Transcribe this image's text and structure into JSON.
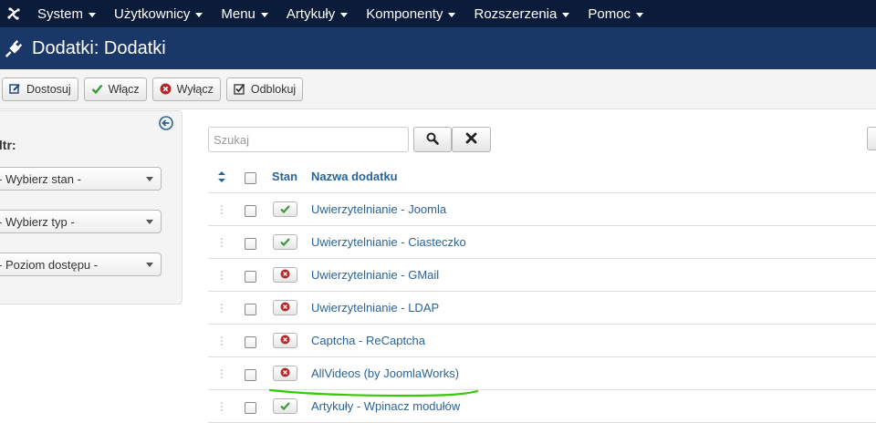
{
  "nav": {
    "items": [
      {
        "label": "System"
      },
      {
        "label": "Użytkownicy"
      },
      {
        "label": "Menu"
      },
      {
        "label": "Artykuły"
      },
      {
        "label": "Komponenty"
      },
      {
        "label": "Rozszerzenia"
      },
      {
        "label": "Pomoc"
      }
    ]
  },
  "header": {
    "title": "Dodatki: Dodatki"
  },
  "toolbar": {
    "customize": "Dostosuj",
    "enable": "Włącz",
    "disable": "Wyłącz",
    "unlock": "Odblokuj"
  },
  "sidebar": {
    "filter_label": "iltr:",
    "state_select": "- Wybierz stan -",
    "type_select": "- Wybierz typ -",
    "access_select": "- Poziom dostępu -"
  },
  "search": {
    "placeholder": "Szukaj"
  },
  "table": {
    "headers": {
      "status": "Stan",
      "name": "Nazwa dodatku"
    },
    "rows": [
      {
        "name": "Uwierzytelnianie - Joomla",
        "enabled": true
      },
      {
        "name": "Uwierzytelnianie - Ciasteczko",
        "enabled": true
      },
      {
        "name": "Uwierzytelnianie - GMail",
        "enabled": false
      },
      {
        "name": "Uwierzytelnianie - LDAP",
        "enabled": false
      },
      {
        "name": "Captcha - ReCaptcha",
        "enabled": false
      },
      {
        "name": "AllVideos (by JoomlaWorks)",
        "enabled": false
      },
      {
        "name": "Artykuły - Wpinacz modułów",
        "enabled": true
      }
    ]
  },
  "colors": {
    "navbar": "#0b1c3b",
    "header": "#1a3867",
    "link": "#2a6496",
    "enabled": "#3c9a3c",
    "disabled": "#b02a2a",
    "annotation": "#33cc00"
  }
}
